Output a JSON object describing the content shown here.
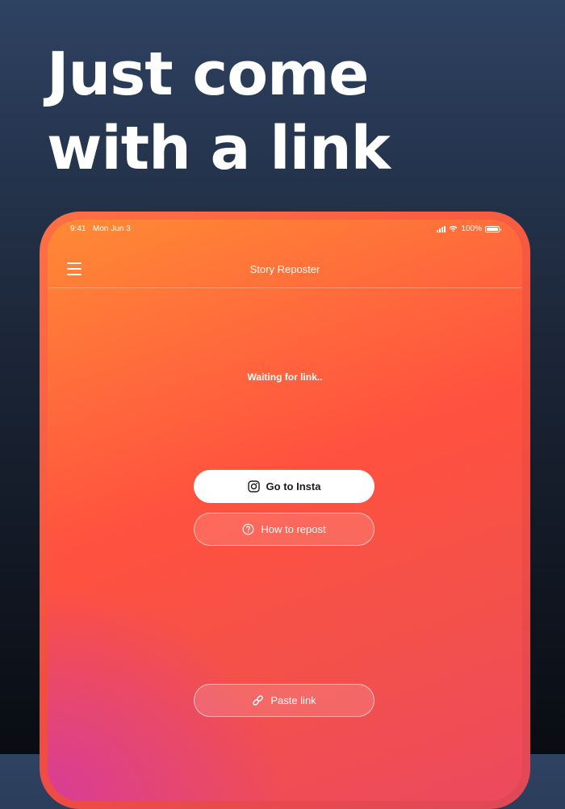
{
  "headline": {
    "line1": "Just come",
    "line2": "with a link"
  },
  "status_bar": {
    "time": "9:41",
    "date": "Mon Jun 3",
    "battery": "100%"
  },
  "app": {
    "title": "Story Reposter",
    "status_text": "Waiting for link..",
    "buttons": {
      "go_to_insta": "Go to Insta",
      "how_to_repost": "How to repost",
      "paste_link": "Paste link"
    }
  },
  "icons": {
    "menu": "hamburger-menu-icon",
    "instagram": "instagram-icon",
    "help": "question-circle-icon",
    "link": "link-icon",
    "signal": "signal-icon",
    "wifi": "wifi-icon",
    "battery": "battery-icon"
  },
  "colors": {
    "background_top": "#2e4262",
    "background_bottom": "#090c12",
    "accent_orange": "#ff8a34",
    "accent_red": "#ff513f",
    "accent_pink": "#d63c9b",
    "primary_button": "#ffffff"
  }
}
